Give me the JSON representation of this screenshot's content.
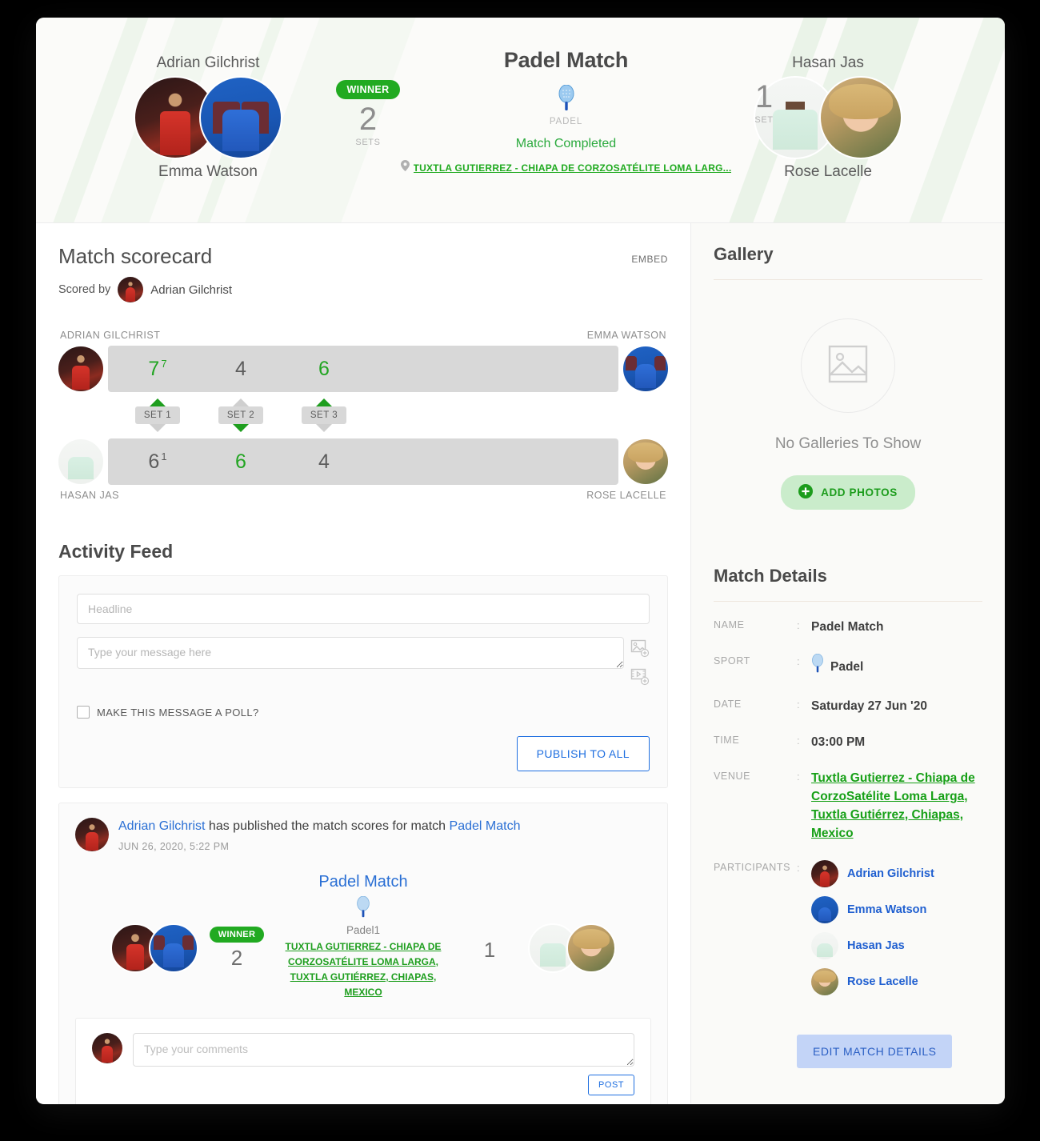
{
  "header": {
    "match_title": "Padel Match",
    "sport_label": "PADEL",
    "status": "Match Completed",
    "venue_short": "TUXTLA GUTIERREZ - CHIAPA DE CORZOSATÉLITE LOMA LARG...",
    "left_team": {
      "top_name": "Adrian Gilchrist",
      "bottom_name": "Emma Watson",
      "winner_label": "WINNER",
      "score": "2",
      "score_label": "SETS"
    },
    "right_team": {
      "top_name": "Hasan Jas",
      "bottom_name": "Rose Lacelle",
      "score": "1",
      "score_label": "SET"
    }
  },
  "scorecard": {
    "title": "Match scorecard",
    "embed_label": "EMBED",
    "scored_by_label": "Scored by",
    "scored_by_name": "Adrian Gilchrist",
    "top_left_player": "ADRIAN GILCHRIST",
    "top_right_player": "EMMA WATSON",
    "bottom_left_player": "HASAN JAS",
    "bottom_right_player": "ROSE LACELLE",
    "set_tabs": [
      "SET 1",
      "SET 2",
      "SET 3"
    ],
    "top_scores": [
      {
        "value": "7",
        "tiebreak": "7",
        "won": true
      },
      {
        "value": "4",
        "tiebreak": "",
        "won": false
      },
      {
        "value": "6",
        "tiebreak": "",
        "won": true
      }
    ],
    "bottom_scores": [
      {
        "value": "6",
        "tiebreak": "1",
        "won": false
      },
      {
        "value": "6",
        "tiebreak": "",
        "won": true
      },
      {
        "value": "4",
        "tiebreak": "",
        "won": false
      }
    ],
    "set_winners": [
      "top",
      "bottom",
      "top"
    ]
  },
  "activity_feed": {
    "title": "Activity Feed",
    "headline_placeholder": "Headline",
    "message_placeholder": "Type your message here",
    "poll_label": "MAKE THIS MESSAGE A POLL?",
    "publish_label": "PUBLISH TO ALL"
  },
  "post": {
    "author": "Adrian Gilchrist",
    "action_text": " has published the match scores for match ",
    "match_link": "Padel Match",
    "timestamp": "JUN 26, 2020, 5:22 PM",
    "match_title": "Padel Match",
    "sport_name": "Padel1",
    "winner_label": "WINNER",
    "left_score": "2",
    "right_score": "1",
    "venue": "TUXTLA GUTIERREZ - CHIAPA DE CORZOSATÉLITE LOMA LARGA, TUXTLA GUTIÉRREZ, CHIAPAS, MEXICO",
    "comment_placeholder": "Type your comments",
    "post_button": "POST"
  },
  "gallery": {
    "title": "Gallery",
    "empty_message": "No Galleries To Show",
    "add_photos_label": "ADD PHOTOS"
  },
  "match_details": {
    "title": "Match Details",
    "rows": [
      {
        "key": "NAME",
        "value": "Padel Match"
      },
      {
        "key": "SPORT",
        "value": "Padel"
      },
      {
        "key": "DATE",
        "value": "Saturday 27 Jun '20"
      },
      {
        "key": "TIME",
        "value": "03:00 PM"
      },
      {
        "key": "VENUE",
        "value": "Tuxtla Gutierrez - Chiapa de CorzoSatélite Loma Larga, Tuxtla Gutiérrez, Chiapas, Mexico"
      }
    ],
    "participants_key": "PARTICIPANTS",
    "participants": [
      "Adrian Gilchrist",
      "Emma Watson",
      "Hasan Jas",
      "Rose Lacelle"
    ],
    "edit_label": "EDIT MATCH DETAILS"
  },
  "icons": {
    "location_pin": "location-pin-icon",
    "padel_racket": "padel-racket-icon",
    "image_placeholder": "image-placeholder-icon",
    "add_image": "add-image-icon",
    "add_video": "add-video-icon",
    "plus": "plus-circle-icon"
  },
  "colors": {
    "green": "#21aa21",
    "blue": "#1f6fe0",
    "gray_bar": "#d8d8d8"
  }
}
